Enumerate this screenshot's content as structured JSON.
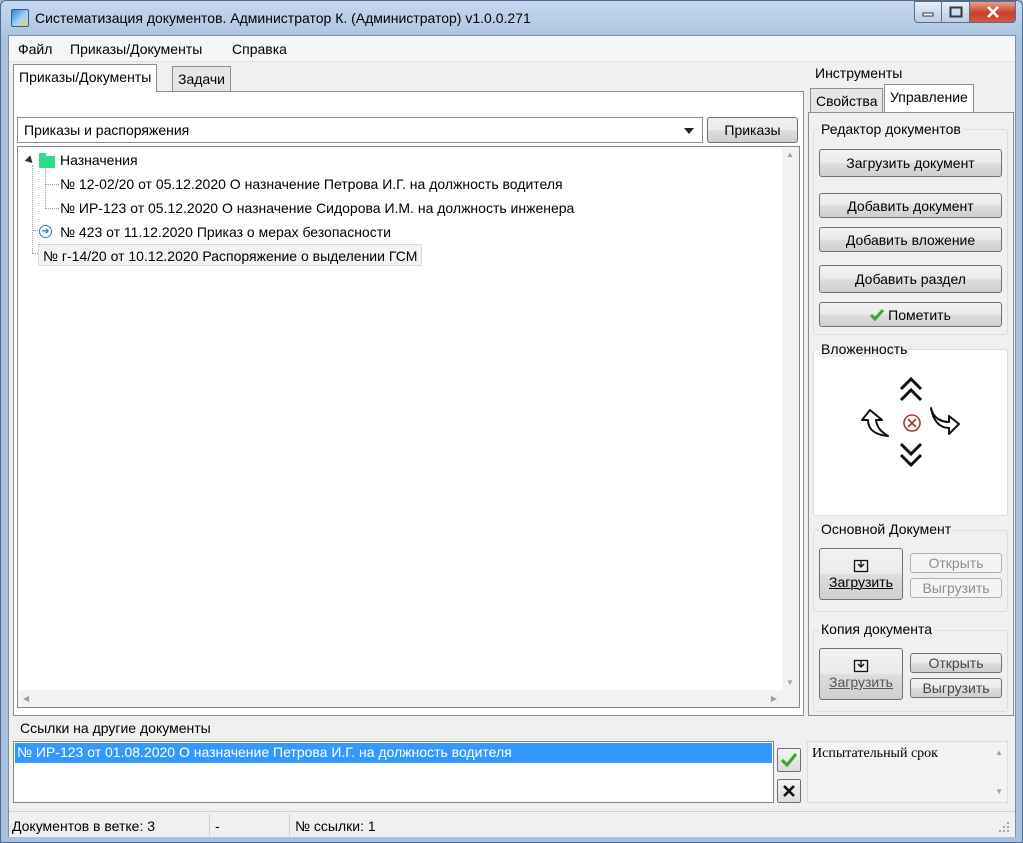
{
  "window": {
    "title": "Систематизация документов.  Администратор К.  (Администратор) v1.0.0.271",
    "min_icon": "minimize-icon",
    "max_icon": "maximize-icon",
    "close_icon": "close-icon"
  },
  "menu": {
    "items": [
      "Файл",
      "Приказы/Документы",
      "Справка"
    ]
  },
  "main_tabs": [
    {
      "label": "Приказы/Документы",
      "active": true
    },
    {
      "label": "Задачи",
      "active": false
    }
  ],
  "filter": {
    "selected": "Приказы и распоряжения",
    "button_label": "Приказы"
  },
  "tree": {
    "folder": "Назначения",
    "children": [
      "№ 12-02/20 от 05.12.2020 О назначение Петрова И.Г. на должность водителя",
      "№ ИР-123 от 05.12.2020 О назначение Сидорова И.М. на должность инженера"
    ],
    "item_linked": "№ 423 от 11.12.2020 Приказ о мерах безопасности",
    "item_selected": "№ г-14/20 от 10.12.2020 Распоряжение о выделении ГСМ"
  },
  "tools": {
    "title": "Инструменты",
    "tabs": [
      {
        "label": "Свойства",
        "active": false
      },
      {
        "label": "Управление",
        "active": true
      }
    ],
    "editor": {
      "title": "Редактор документов",
      "load_doc": "Загрузить документ",
      "add_doc": "Добавить документ",
      "add_attachment": "Добавить вложение",
      "add_section": "Добавить раздел",
      "mark": "Пометить"
    },
    "nesting": {
      "title": "Вложенность"
    },
    "main_doc": {
      "title": "Основной  Документ",
      "load": "Загрузить",
      "open": "Открыть",
      "unload": "Выгрузить"
    },
    "copy_doc": {
      "title": "Копия документа",
      "load": "Загрузить",
      "open": "Открыть",
      "unload": "Выгрузить"
    }
  },
  "links": {
    "title": "Ссылки на другие документы",
    "items": [
      "№ ИР-123 от 01.08.2020 О назначение Петрова И.Г. на должность водителя"
    ],
    "note": "Испытательный срок"
  },
  "status": {
    "docs_in_branch": "Документов в ветке: 3",
    "dash": "-",
    "link_no": "№ ссылки: 1"
  },
  "colors": {
    "selection": "#3399ff",
    "folder": "#2fdb8f",
    "check": "#3aa832"
  }
}
